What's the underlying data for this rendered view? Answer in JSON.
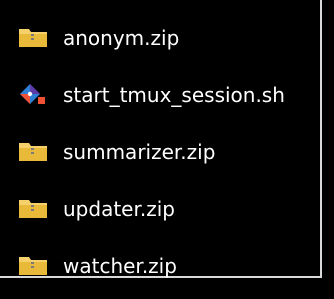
{
  "files": [
    {
      "name": "anonym.zip",
      "icon": "zip-folder-icon"
    },
    {
      "name": "start_tmux_session.sh",
      "icon": "git-bash-script-icon"
    },
    {
      "name": "summarizer.zip",
      "icon": "zip-folder-icon"
    },
    {
      "name": "updater.zip",
      "icon": "zip-folder-icon"
    },
    {
      "name": "watcher.zip",
      "icon": "zip-folder-icon"
    }
  ],
  "colors": {
    "background": "#000000",
    "text": "#ffffff",
    "folder_body": "#e9b93a",
    "folder_tab": "#f6d06b",
    "zipper": "#7a7a7a",
    "script_orange": "#f05033",
    "script_blue": "#2f7fd6",
    "script_purple": "#5c3aa8",
    "border": "#d9d9d9"
  }
}
